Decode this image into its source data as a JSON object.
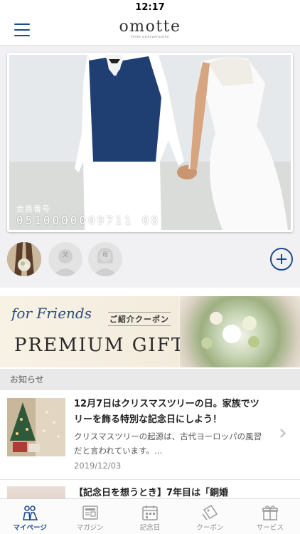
{
  "status_bar": {
    "time": "12:17"
  },
  "header": {
    "logo": "omotte",
    "logo_sub": "from anniversaire"
  },
  "member_card": {
    "number_label": "会員番号",
    "number": "0510000009711 08"
  },
  "family": [
    {
      "name": "couple-photo",
      "label": ""
    },
    {
      "name": "father",
      "label": "父"
    },
    {
      "name": "mother",
      "label": "母"
    }
  ],
  "banner": {
    "script": "for Friends",
    "coupon": "ご紹介クーポン",
    "title": "PREMIUM GIFT"
  },
  "news_section": {
    "title": "お知らせ"
  },
  "news": [
    {
      "title": "12月7日はクリスマスツリーの日。家族でツリーを飾る特別な記念日にしよう！",
      "description": "クリスマスツリーの起源は、古代ヨーロッパの風習だと言われています。…",
      "date": "2019/12/03"
    },
    {
      "title": "【記念日を想うとき】7年目は「銅婚"
    }
  ],
  "tabs": [
    {
      "label": "マイページ",
      "icon": "people-icon",
      "active": true
    },
    {
      "label": "マガジン",
      "icon": "news-icon",
      "active": false
    },
    {
      "label": "記念日",
      "icon": "calendar-icon",
      "active": false
    },
    {
      "label": "クーポン",
      "icon": "coupon-icon",
      "active": false
    },
    {
      "label": "サービス",
      "icon": "gift-icon",
      "active": false
    }
  ],
  "colors": {
    "accent": "#1e4a8c",
    "section_bg": "#e9e9e9",
    "card_area_bg": "#f1f1f3"
  }
}
